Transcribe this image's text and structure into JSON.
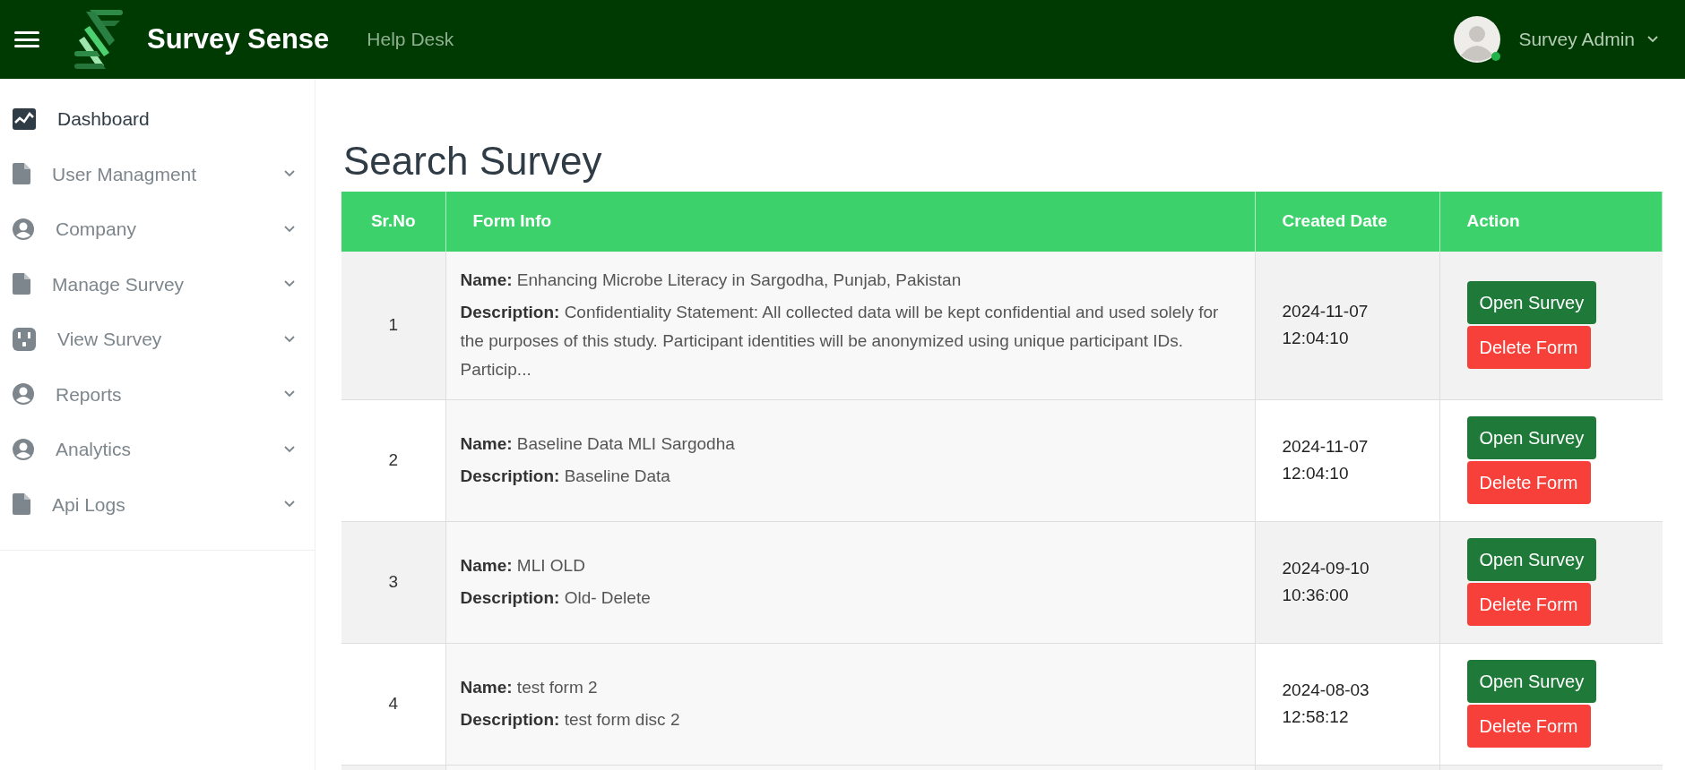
{
  "header": {
    "brand": "Survey Sense",
    "link": "Help Desk",
    "user": "Survey Admin",
    "online": true
  },
  "sidebar": {
    "items": [
      {
        "label": "Dashboard",
        "selected": true,
        "expandable": false
      },
      {
        "label": "User Managment",
        "selected": false,
        "expandable": true
      },
      {
        "label": "Company",
        "selected": false,
        "expandable": true
      },
      {
        "label": "Manage Survey",
        "selected": false,
        "expandable": true
      },
      {
        "label": "View Survey",
        "selected": false,
        "expandable": true
      },
      {
        "label": "Reports",
        "selected": false,
        "expandable": true
      },
      {
        "label": "Analytics",
        "selected": false,
        "expandable": true
      },
      {
        "label": "Api Logs",
        "selected": false,
        "expandable": true
      }
    ]
  },
  "page_title": "Search Survey",
  "table": {
    "columns": [
      "Sr.No",
      "Form Info",
      "Created Date",
      "Action"
    ],
    "rows": [
      {
        "sr_no": "1",
        "name_label": "Name:",
        "name": "Enhancing Microbe Literacy in Sargodha, Punjab, Pakistan",
        "description_label": "Description:",
        "description": "Confidentiality Statement: All collected data will be kept confidential and used solely for the purposes of this study. Participant identities will be anonymized using unique participant IDs. Particip...",
        "created": "2024-11-07 12:04:10",
        "open_button": "Open Survey",
        "delete_button": "Delete Form"
      },
      {
        "sr_no": "2",
        "name_label": "Name:",
        "name": "Baseline Data MLI Sargodha",
        "description_label": "Description:",
        "description": "Baseline Data",
        "created": "2024-11-07 12:04:10",
        "open_button": "Open Survey",
        "delete_button": "Delete Form"
      },
      {
        "sr_no": "3",
        "name_label": "Name:",
        "name": "MLI OLD",
        "description_label": "Description:",
        "description": "Old- Delete",
        "created": "2024-09-10 10:36:00",
        "open_button": "Open Survey",
        "delete_button": "Delete Form"
      },
      {
        "sr_no": "4",
        "name_label": "Name:",
        "name": "test form 2",
        "description_label": "Description:",
        "description": "test form disc 2",
        "created": "2024-08-03 12:58:12",
        "open_button": "Open Survey",
        "delete_button": "Delete Form"
      }
    ]
  }
}
